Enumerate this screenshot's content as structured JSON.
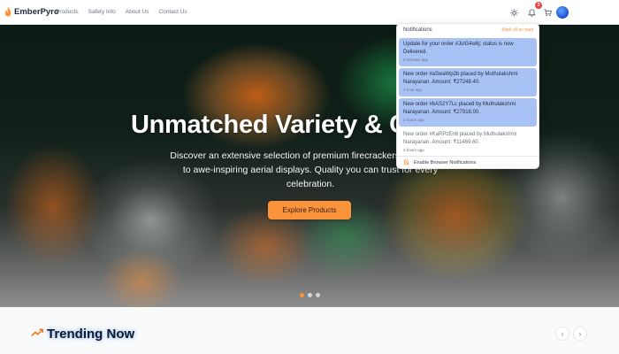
{
  "brand": {
    "name": "EmberPyro",
    "logo_icon": "flame-icon",
    "accent": "#fb923c"
  },
  "nav": [
    "Products",
    "Safety Info",
    "About Us",
    "Contact Us"
  ],
  "header_icons": {
    "theme": "sun-icon",
    "notifications": "bell-icon",
    "cart": "cart-icon"
  },
  "notification_count": "3",
  "hero": {
    "title": "Unmatched Variety & C",
    "subtitle": "Discover an extensive selection of premium firecrackers, fr sparklers to awe-inspiring aerial displays. Quality you can trust for every celebration.",
    "cta": "Explore Products",
    "slides": 3,
    "active_slide": 1
  },
  "trending": {
    "icon": "trending-up-icon",
    "title": "Trending Now",
    "prev": "‹",
    "next": "›"
  },
  "notifications": {
    "title": "Notifications",
    "mark_all": "Mark all as read",
    "items": [
      {
        "message": "Update for your order #JulG4w6j: status is now Delivered.",
        "time": "5 minutes ago",
        "unread": true
      },
      {
        "message": "New order #aSwaWp2b placed by Muthulakshmi Narayanan. Amount: ₹27248.40.",
        "time": "1 hour ago",
        "unread": true
      },
      {
        "message": "New order #bAS2Y7Lc placed by Muthulakshmi Narayanan. Amount: ₹27918.00.",
        "time": "2 hours ago",
        "unread": true
      },
      {
        "message": "New order #KaRPzEn6 placed by Muthulakshmi Narayanan. Amount: ₹11469.60.",
        "time": "2 hours ago",
        "unread": false
      }
    ],
    "footer": "Enable Browser Notifications",
    "footer_icon": "bell-off-icon"
  }
}
